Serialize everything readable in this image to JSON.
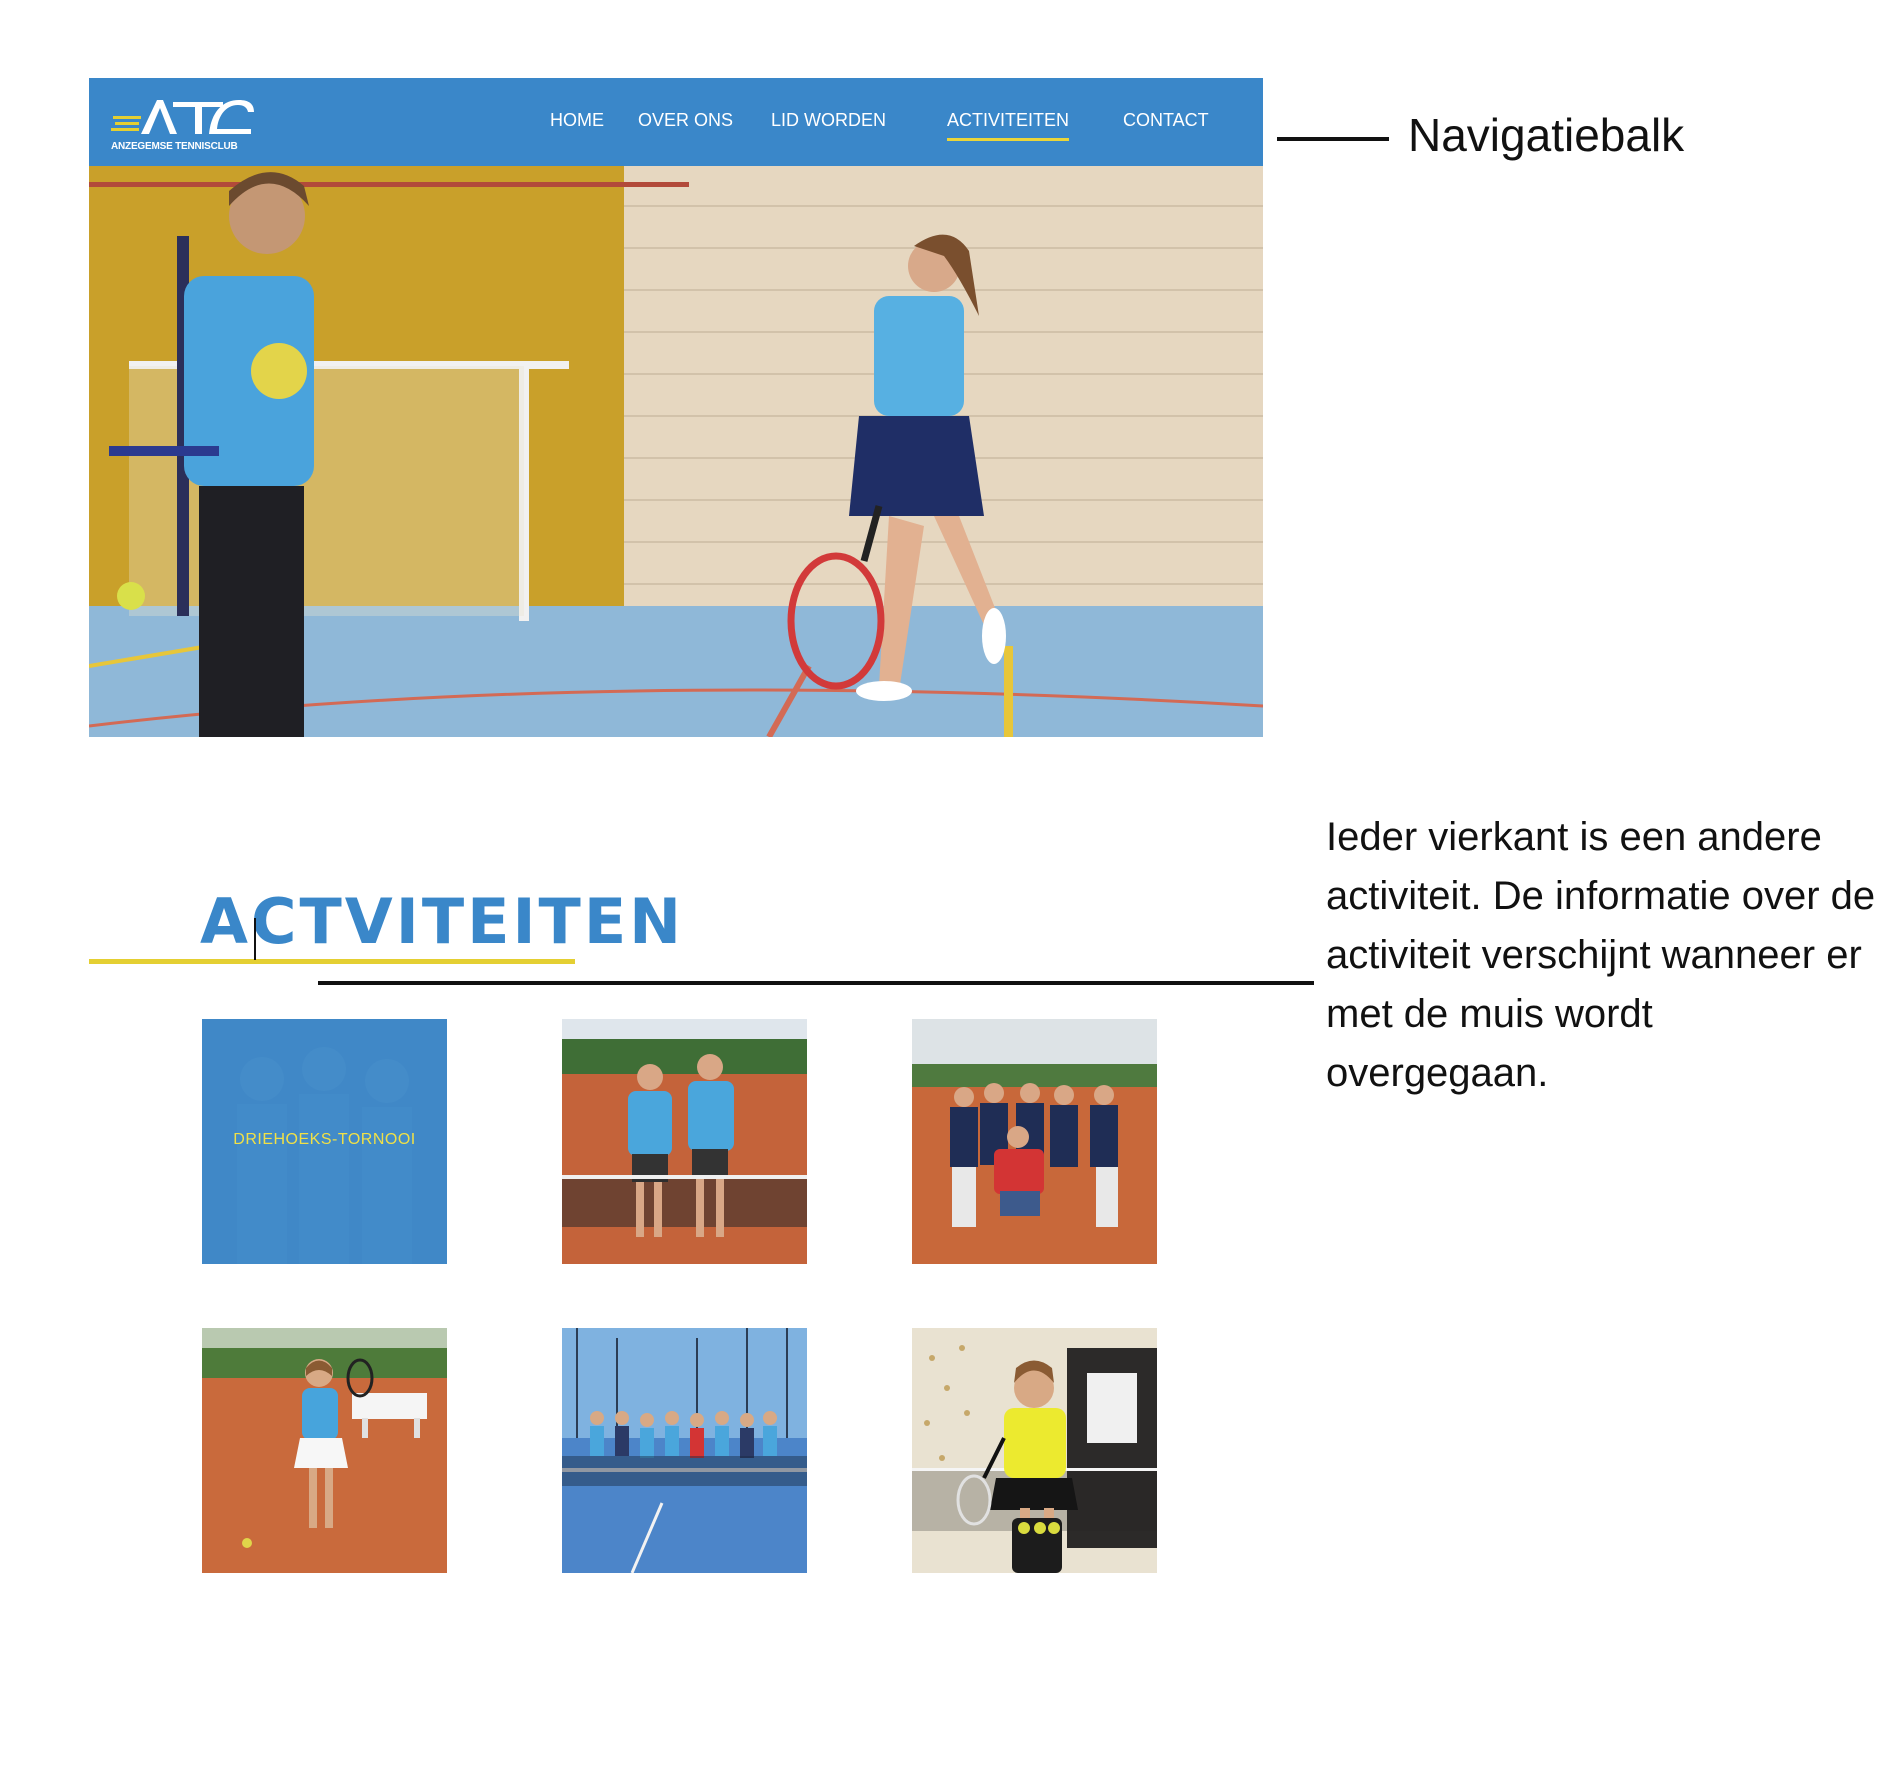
{
  "navbar": {
    "logo_text": "ATC",
    "logo_subtitle": "ANZEGEMSE TENNISCLUB",
    "items": [
      {
        "label": "HOME",
        "active": false
      },
      {
        "label": "OVER ONS",
        "active": false
      },
      {
        "label": "LID WORDEN",
        "active": false
      },
      {
        "label": "ACTIVITEITEN",
        "active": true
      },
      {
        "label": "CONTACT",
        "active": false
      }
    ]
  },
  "annotations": {
    "navbar_label": "Navigatiebalk",
    "tiles_description": "Ieder vierkant is een andere activiteit. De informatie over de activiteit  verschijnt wanneer er met de muis wordt overgegaan."
  },
  "section": {
    "title": "ACTVITEITEN"
  },
  "tiles": [
    {
      "label": "DRIEHOEKS-TORNOOI",
      "photo": "group-blurred",
      "hovered": true
    },
    {
      "label": "",
      "photo": "two-boys-clay-court",
      "hovered": false
    },
    {
      "label": "",
      "photo": "group-adults-clay-court",
      "hovered": false
    },
    {
      "label": "",
      "photo": "girl-clay-court",
      "hovered": false
    },
    {
      "label": "",
      "photo": "group-blue-court",
      "hovered": false
    },
    {
      "label": "",
      "photo": "girl-yellow-indoor",
      "hovered": false
    }
  ],
  "colors": {
    "brand_blue": "#3a87c9",
    "accent_yellow": "#e4cf32",
    "clay": "#c8663a"
  }
}
